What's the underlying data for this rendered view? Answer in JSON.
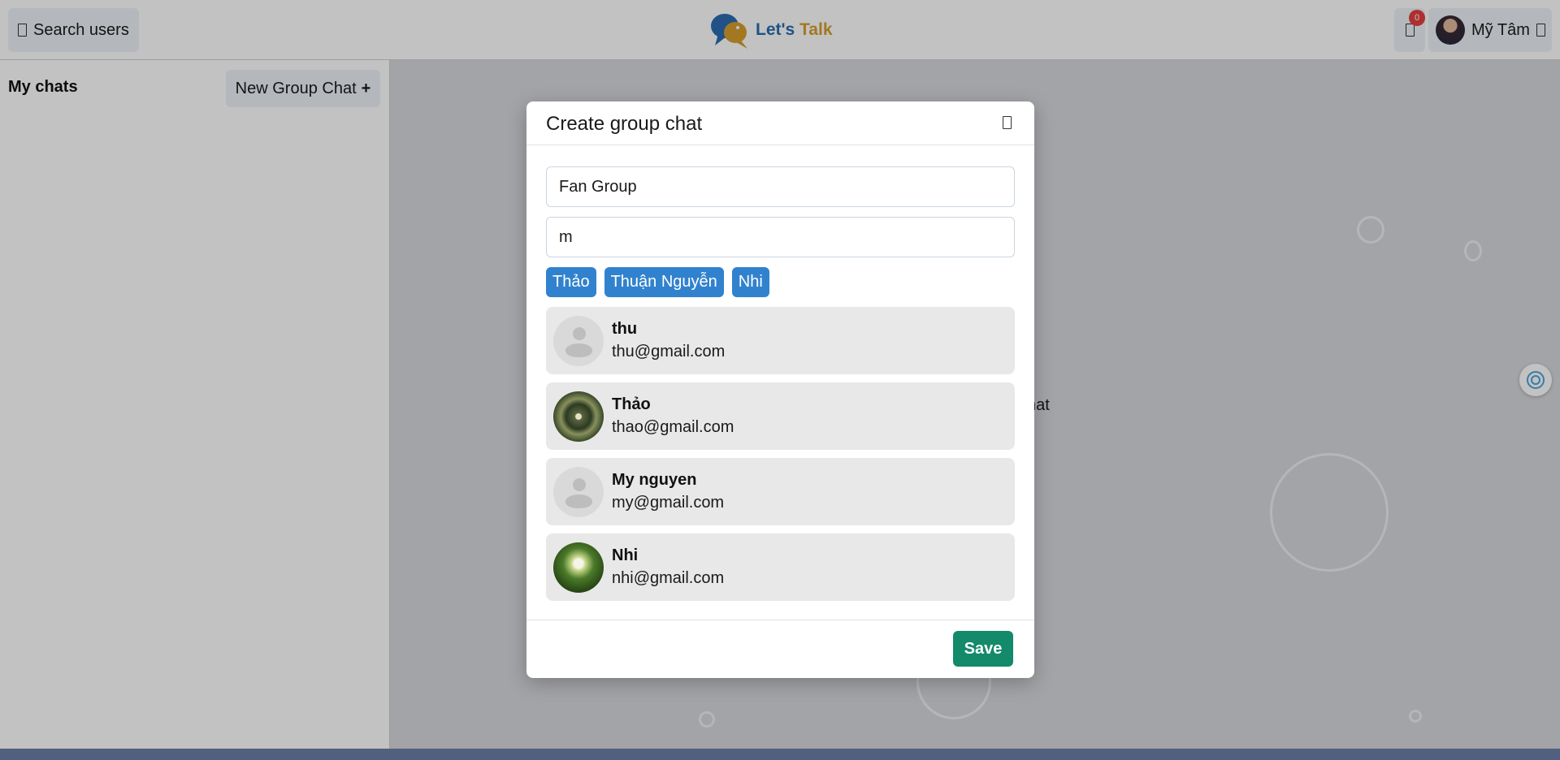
{
  "header": {
    "search_label": "Search users",
    "logo": {
      "lets": "Let's",
      "talk": "Talk"
    },
    "notification_count": "0",
    "profile_name": "Mỹ Tâm"
  },
  "sidebar": {
    "title": "My chats",
    "new_group_label": "New Group Chat",
    "new_group_plus": "+"
  },
  "main": {
    "hint_fragment": "hat"
  },
  "modal": {
    "title": "Create group chat",
    "group_name_value": "Fan Group",
    "search_value": "m",
    "selected_chips": [
      "Thảo",
      "Thuận Nguyễn",
      "Nhi"
    ],
    "users": [
      {
        "name": "thu",
        "email": "thu@gmail.com",
        "avatar": "default"
      },
      {
        "name": "Thảo",
        "email": "thao@gmail.com",
        "avatar": "photo"
      },
      {
        "name": "My nguyen",
        "email": "my@gmail.com",
        "avatar": "default"
      },
      {
        "name": "Nhi",
        "email": "nhi@gmail.com",
        "avatar": "photo"
      }
    ],
    "save_label": "Save"
  },
  "colors": {
    "chip": "#3182ce",
    "save": "#138a6a",
    "badge": "#e53e3e",
    "logo_blue": "#2b6cb0",
    "logo_gold": "#d69e2e"
  }
}
